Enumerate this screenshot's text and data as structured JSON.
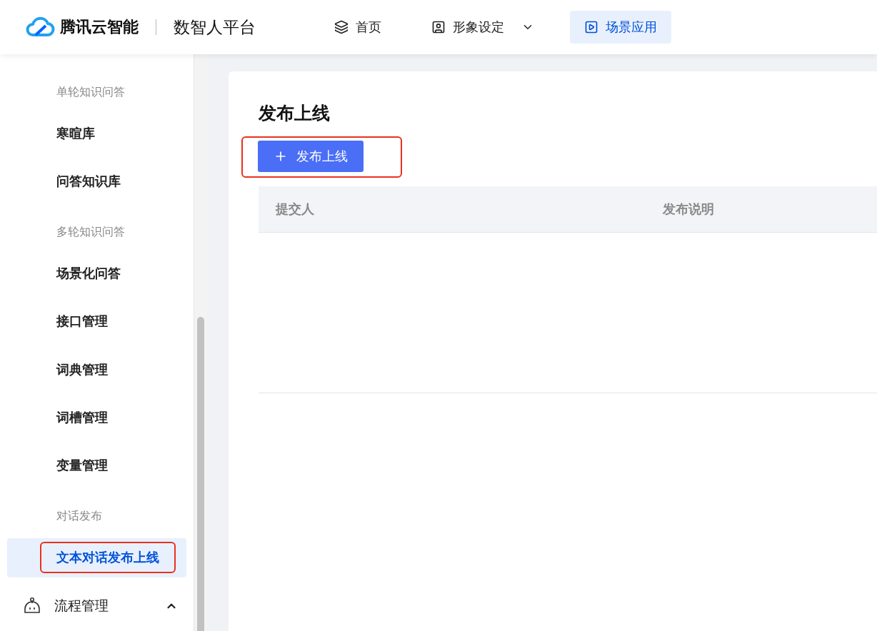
{
  "header": {
    "brand": "腾讯云智能",
    "product": "数智人平台",
    "nav": [
      {
        "label": "首页",
        "selected": false,
        "dropdown": false
      },
      {
        "label": "形象设定",
        "selected": false,
        "dropdown": true
      },
      {
        "label": "场景应用",
        "selected": true,
        "dropdown": false
      }
    ]
  },
  "sidebar": [
    {
      "kind": "group",
      "label": "单轮知识问答"
    },
    {
      "kind": "item",
      "label": "寒暄库",
      "selected": false,
      "highlighted": false
    },
    {
      "kind": "item",
      "label": "问答知识库",
      "selected": false,
      "highlighted": false
    },
    {
      "kind": "group",
      "label": "多轮知识问答"
    },
    {
      "kind": "item",
      "label": "场景化问答",
      "selected": false,
      "highlighted": false
    },
    {
      "kind": "item",
      "label": "接口管理",
      "selected": false,
      "highlighted": false
    },
    {
      "kind": "item",
      "label": "词典管理",
      "selected": false,
      "highlighted": false
    },
    {
      "kind": "item",
      "label": "词槽管理",
      "selected": false,
      "highlighted": false
    },
    {
      "kind": "item",
      "label": "变量管理",
      "selected": false,
      "highlighted": false
    },
    {
      "kind": "group",
      "label": "对话发布"
    },
    {
      "kind": "item",
      "label": "文本对话发布上线",
      "selected": true,
      "highlighted": true
    },
    {
      "kind": "menu",
      "label": "流程管理",
      "expanded": true
    }
  ],
  "content": {
    "title": "发布上线",
    "button": {
      "label": "发布上线",
      "highlighted": true
    },
    "table": {
      "columns": [
        "提交人",
        "发布说明"
      ]
    }
  }
}
